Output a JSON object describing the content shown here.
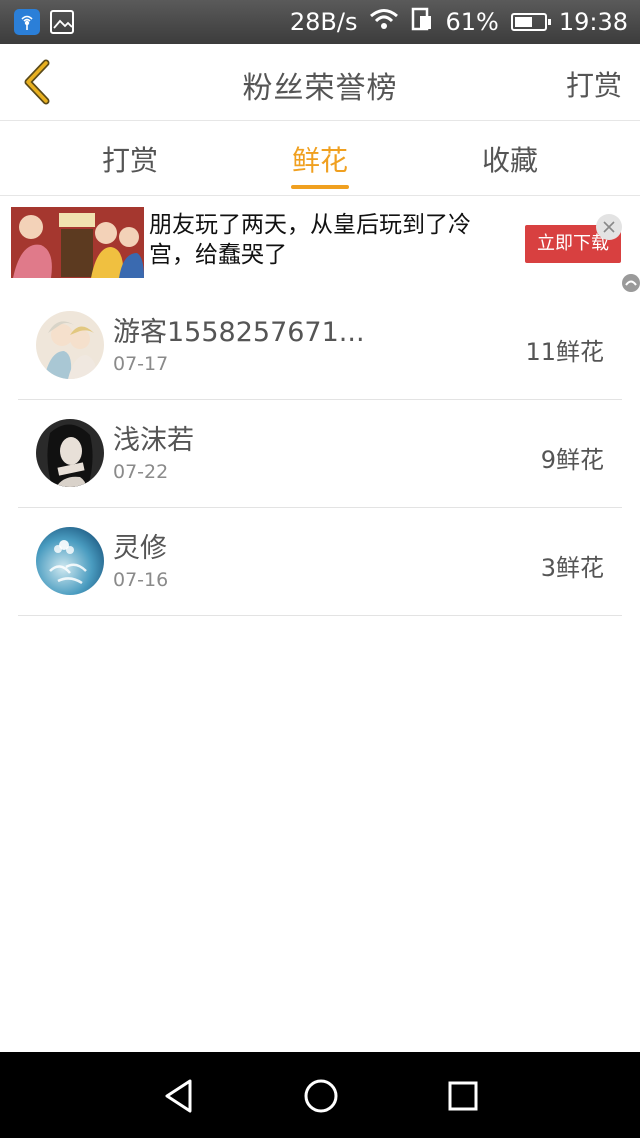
{
  "status_bar": {
    "net_speed": "28B/s",
    "battery": "61%",
    "battery_level": 0.61,
    "time": "19:38"
  },
  "header": {
    "title": "粉丝荣誉榜",
    "action": "打赏"
  },
  "tabs": [
    {
      "label": "打赏",
      "active": false
    },
    {
      "label": "鲜花",
      "active": true
    },
    {
      "label": "收藏",
      "active": false
    }
  ],
  "ad": {
    "text": "朋友玩了两天，从皇后玩到了冷宫，给蠢哭了",
    "cta": "立即下载"
  },
  "fans": [
    {
      "name": "游客1558257671...",
      "date": "07-17",
      "amount": "11鲜花"
    },
    {
      "name": "浅沫若",
      "date": "07-22",
      "amount": "9鲜花"
    },
    {
      "name": "灵修",
      "date": "07-16",
      "amount": "3鲜花"
    }
  ],
  "colors": {
    "accent": "#f0a020",
    "cta": "#d84040"
  }
}
